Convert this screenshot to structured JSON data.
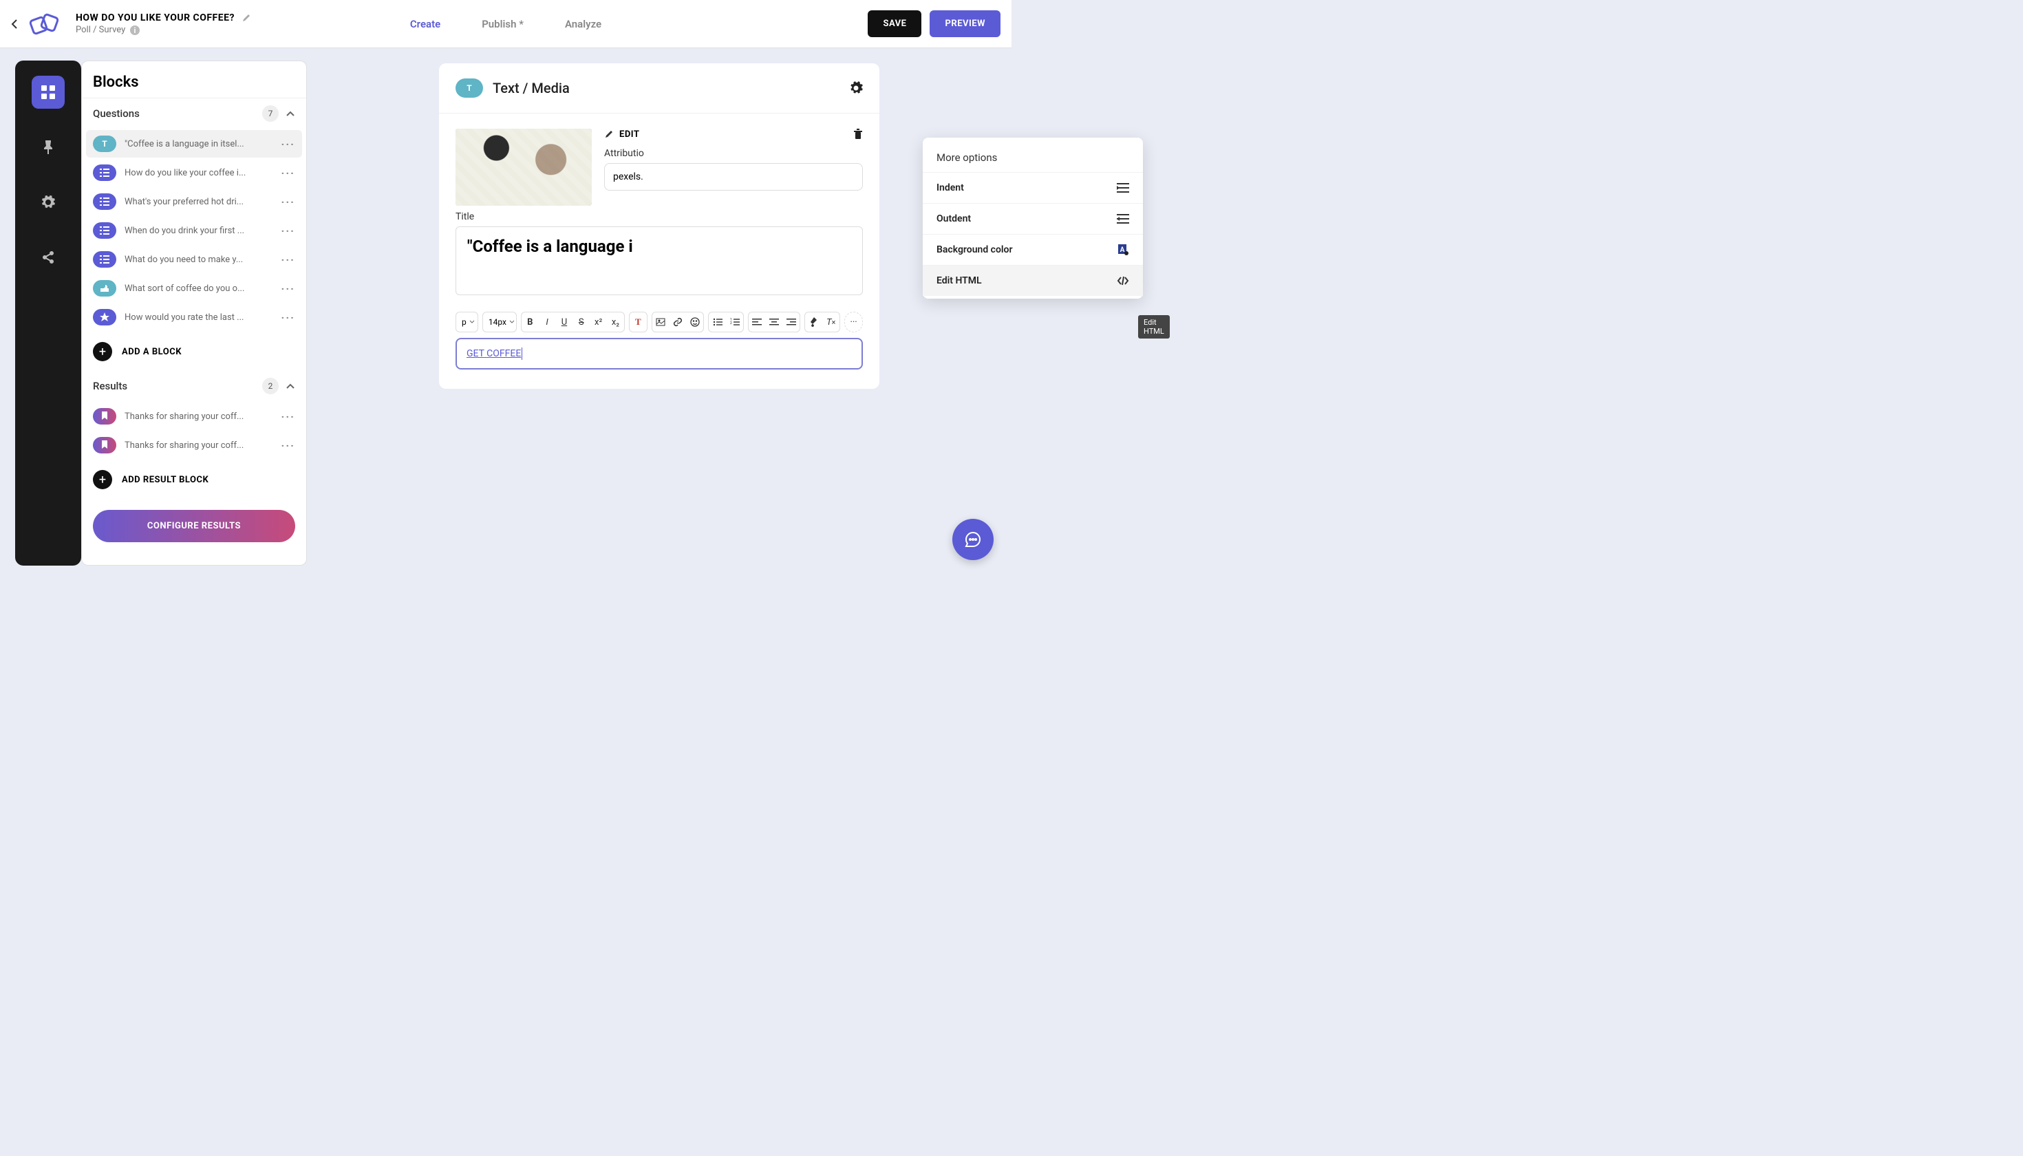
{
  "header": {
    "title": "HOW DO YOU LIKE YOUR COFFEE?",
    "subtitle": "Poll / Survey",
    "tabs": {
      "create": "Create",
      "publish": "Publish *",
      "analyze": "Analyze"
    },
    "save": "SAVE",
    "preview": "PREVIEW"
  },
  "panel": {
    "title": "Blocks",
    "questions_label": "Questions",
    "questions_count": "7",
    "results_label": "Results",
    "results_count": "2",
    "add_block": "ADD A BLOCK",
    "add_result": "ADD RESULT BLOCK",
    "configure": "CONFIGURE RESULTS",
    "questions": [
      {
        "pill": "T",
        "text": "\"Coffee is a language in itsel..."
      },
      {
        "pill": "L",
        "text": "How do you like your coffee i..."
      },
      {
        "pill": "L",
        "text": "What's your preferred hot dri..."
      },
      {
        "pill": "L",
        "text": "When do you drink your first ..."
      },
      {
        "pill": "L",
        "text": "What do you need to make y..."
      },
      {
        "pill": "TH",
        "text": "What sort of coffee do you o..."
      },
      {
        "pill": "S",
        "text": "How would you rate the last ..."
      }
    ],
    "results": [
      {
        "text": "Thanks for sharing your coff..."
      },
      {
        "text": "Thanks for sharing your coff..."
      }
    ]
  },
  "editor": {
    "block_type_label": "Text / Media",
    "edit_label": "EDIT",
    "attribution_label": "Attributio",
    "attribution_value": "pexels.",
    "title_label": "Title",
    "title_value": "\"Coffee is a language i",
    "font_size": "14px",
    "para": "p",
    "description_value": "GET COFFEE"
  },
  "popover": {
    "title": "More options",
    "indent": "Indent",
    "outdent": "Outdent",
    "bg": "Background color",
    "edit_html": "Edit HTML"
  },
  "tooltip": "Edit HTML"
}
